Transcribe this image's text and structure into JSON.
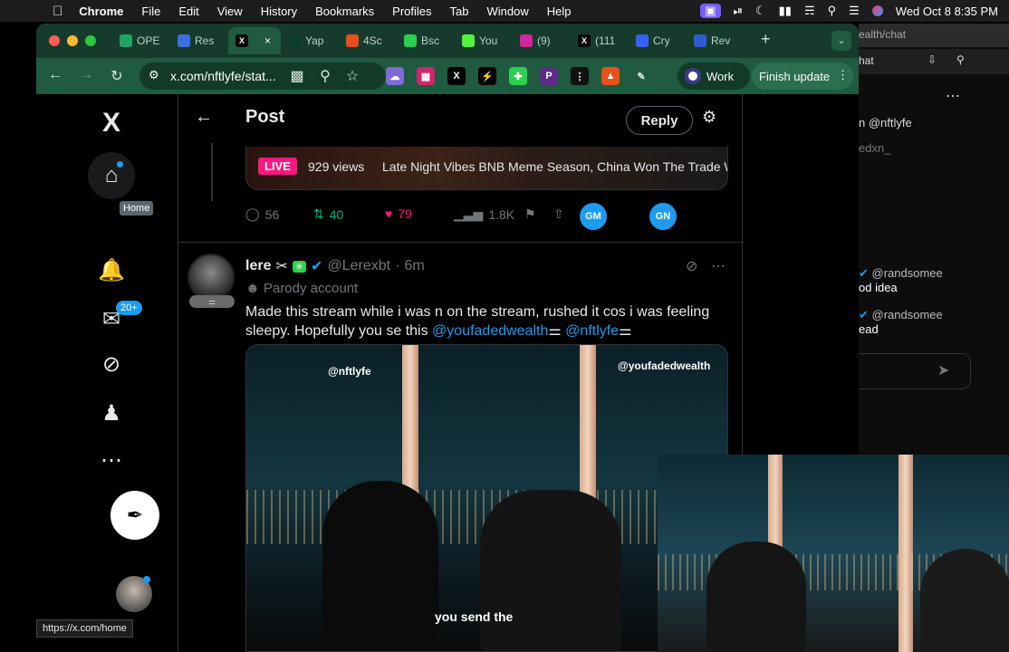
{
  "menubar": {
    "app_name": "Chrome",
    "menus": [
      "File",
      "Edit",
      "View",
      "History",
      "Bookmarks",
      "Profiles",
      "Tab",
      "Window",
      "Help"
    ],
    "clock": "Wed Oct 8  8:35 PM"
  },
  "tabs": [
    {
      "label": "OPE",
      "favicon": "sheets-icon",
      "color": "#1fa463"
    },
    {
      "label": "Res",
      "favicon": "r-icon",
      "color": "#3b6fe0"
    },
    {
      "label": "",
      "favicon": "x-icon",
      "color": "#000000",
      "active": true
    },
    {
      "label": "Yap",
      "favicon": "kaito-icon",
      "color": "#0f3b2e"
    },
    {
      "label": "4Sc",
      "favicon": "4-icon",
      "color": "#e8501a"
    },
    {
      "label": "Bsc",
      "favicon": "grid-icon",
      "color": "#2bd14e"
    },
    {
      "label": "You",
      "favicon": "k-icon",
      "color": "#53f23b"
    },
    {
      "label": "(9)",
      "favicon": "instagram-icon",
      "color": "#d6249f"
    },
    {
      "label": "(111",
      "favicon": "x-icon",
      "color": "#000000"
    },
    {
      "label": "Cry",
      "favicon": "c-icon",
      "color": "#3861fb"
    },
    {
      "label": "Rev",
      "favicon": "r-doc-icon",
      "color": "#2f5bd0"
    }
  ],
  "toolbar": {
    "url": "x.com/nftlyfe/stat...",
    "work_label": "Work",
    "finish_label": "Finish update"
  },
  "nav": {
    "tooltip": "Home",
    "notif_badge": "20+",
    "status_url": "https://x.com/home"
  },
  "header": {
    "title": "Post",
    "reply_label": "Reply"
  },
  "live_card": {
    "badge": "LIVE",
    "views": "929 views",
    "title": "Late Night Vibes BNB Meme Season, China Won The Trade War"
  },
  "actions": {
    "replies": "56",
    "reposts": "40",
    "likes": "79",
    "views": "1.8K",
    "badge1": "GM",
    "badge2": "GN"
  },
  "tweet": {
    "name": "lere",
    "handle": "@Lerexbt",
    "time": "6m",
    "parody_label": "Parody account",
    "text_line1": "Made this stream while i was n on the stream, rushed it cos i was feeling",
    "text_line2": "sleepy. Hopefully you se this",
    "mention1": "@youfadedwealth",
    "mention2": "@nftlyfe",
    "video": {
      "overlay_left": "@nftlyfe",
      "overlay_right": "@youfadedwealth",
      "caption": "you send the"
    }
  },
  "right_panel": {
    "url_fragment": "ealth/chat",
    "tab_fragment": "hat",
    "handle1": "n @nftlyfe",
    "handle2": "edxn_",
    "msg1_handle": "@randsomee",
    "msg1_text": "od idea",
    "msg2_handle": "@randsomee",
    "msg2_text": "ead"
  }
}
